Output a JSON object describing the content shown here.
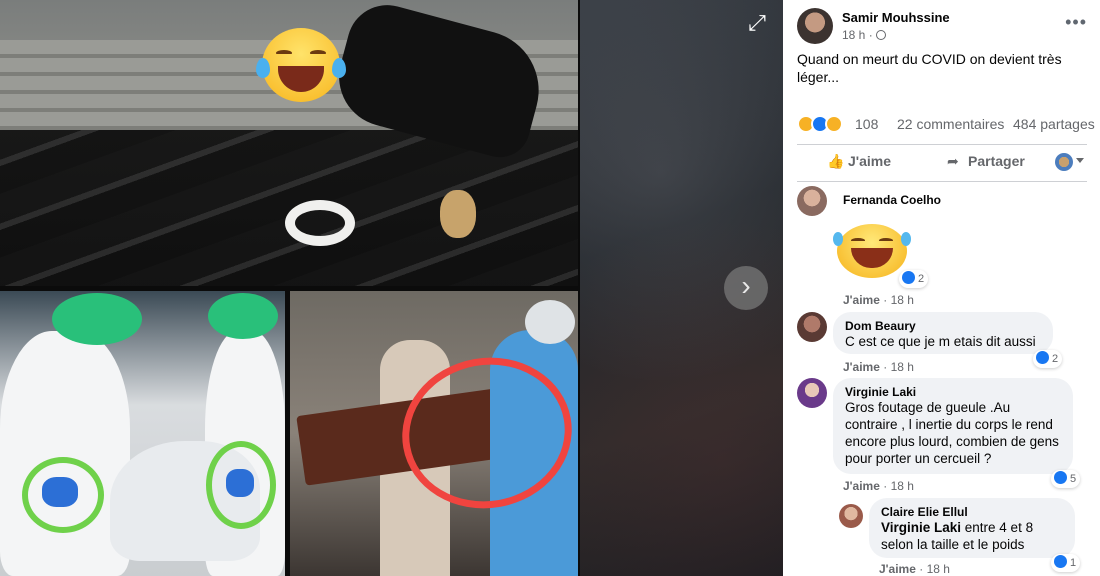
{
  "viewer": {
    "expand_icon": "expand-icon",
    "next_icon": "chevron-right-icon",
    "expand_glyph": "⤢",
    "next_glyph": "›"
  },
  "post": {
    "author": "Samir Mouhssine",
    "time": "18 h ·",
    "more": "•••",
    "text": "Quand on meurt du COVID on devient très léger...",
    "reaction_count": "108",
    "comments_count": "22 commentaires",
    "shares_count": "484 partages",
    "like_label": "J'aime",
    "share_label": "Partager",
    "like_glyph": "👍",
    "share_glyph": "➦"
  },
  "colors": {
    "link_blue": "#1877f2",
    "meta_gray": "#65676b",
    "bubble_bg": "#f0f2f5"
  },
  "comments": [
    {
      "name": "Fernanda Coelho",
      "text": "",
      "reaction_count": "2",
      "like": "J'aime",
      "time": "· 18 h"
    },
    {
      "name": "Dom Beaury",
      "text": "C est ce que je m etais dit aussi",
      "reaction_count": "2",
      "like": "J'aime",
      "time": "· 18 h"
    },
    {
      "name": "Virginie Laki",
      "text": "Gros foutage de gueule .Au contraire , l inertie du corps le rend encore plus lourd, combien de gens pour porter un cercueil ?",
      "reaction_count": "5",
      "like": "J'aime",
      "time": "· 18 h"
    },
    {
      "name": "Claire Elie Ellul",
      "mention": "Virginie Laki",
      "text": " entre 4 et 8 selon la taille et le poids",
      "reaction_count": "1",
      "like": "J'aime",
      "time": "· 18 h"
    }
  ]
}
